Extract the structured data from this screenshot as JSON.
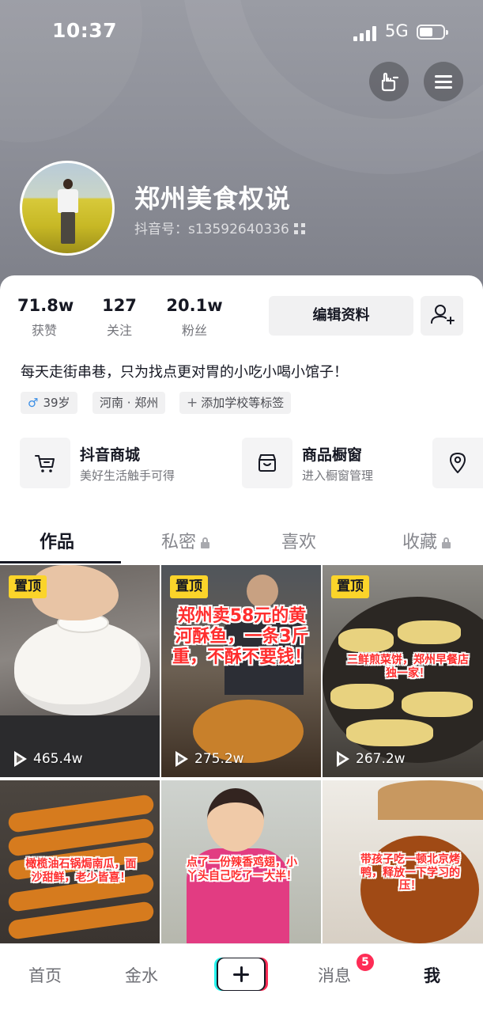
{
  "status_bar": {
    "time": "10:37",
    "network": "5G"
  },
  "header": {
    "username": "郑州美食权说",
    "douyin_id": "抖音号：s13592640336"
  },
  "stats": [
    {
      "value": "71.8w",
      "label": "获赞"
    },
    {
      "value": "127",
      "label": "关注"
    },
    {
      "value": "20.1w",
      "label": "粉丝"
    }
  ],
  "actions": {
    "edit_profile": "编辑资料"
  },
  "bio": "每天走街串巷，只为找点更对胃的小吃小喝小馆子！",
  "tags": {
    "gender_symbol": "♂",
    "age": "39岁",
    "location": "河南 · 郑州",
    "add_school": "添加学校等标签"
  },
  "services": [
    {
      "title": "抖音商城",
      "subtitle": "美好生活触手可得",
      "icon": "cart-icon"
    },
    {
      "title": "商品橱窗",
      "subtitle": "进入橱窗管理",
      "icon": "shop-window-icon"
    }
  ],
  "tabs": [
    {
      "label": "作品",
      "active": true
    },
    {
      "label": "私密",
      "locked": true
    },
    {
      "label": "喜欢"
    },
    {
      "label": "收藏",
      "locked": true
    }
  ],
  "videos": [
    {
      "pinned": "置顶",
      "plays": "465.4w",
      "caption": ""
    },
    {
      "pinned": "置顶",
      "plays": "275.2w",
      "caption": "郑州卖58元的黄河酥鱼，一条3斤重，不酥不要钱！"
    },
    {
      "pinned": "置顶",
      "plays": "267.2w",
      "caption": "三鲜煎菜饼，郑州早餐店独一家！"
    },
    {
      "caption": "橄榄油石锅焗南瓜，面沙甜鲜，老少皆喜！"
    },
    {
      "caption": "点了一份辣香鸡翅，小丫头自己吃了一大半！"
    },
    {
      "caption": "带孩子吃一顿北京烤鸭，释放一下学习的压！"
    }
  ],
  "bottom_nav": {
    "home": "首页",
    "second": "金水",
    "messages": "消息",
    "messages_badge": "5",
    "me": "我"
  },
  "colors": {
    "accent_red": "#fe2c55",
    "accent_cyan": "#25f4ee",
    "pin_yellow": "#fbd42a",
    "caption_red": "#ff2e2e"
  }
}
